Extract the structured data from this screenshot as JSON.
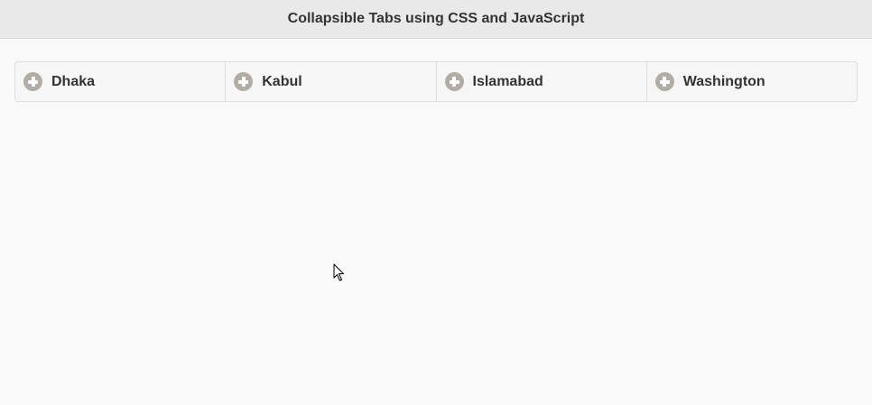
{
  "header": {
    "title": "Collapsible Tabs using CSS and JavaScript"
  },
  "tabs": [
    {
      "label": "Dhaka",
      "icon": "plus-circle-icon"
    },
    {
      "label": "Kabul",
      "icon": "plus-circle-icon"
    },
    {
      "label": "Islamabad",
      "icon": "plus-circle-icon"
    },
    {
      "label": "Washington",
      "icon": "plus-circle-icon"
    }
  ],
  "colors": {
    "page_background": "#f9f9f9",
    "header_background": "#e9e9e9",
    "tab_background": "#f6f6f6",
    "icon_color": "#b2ada4",
    "text_color": "#333333"
  }
}
